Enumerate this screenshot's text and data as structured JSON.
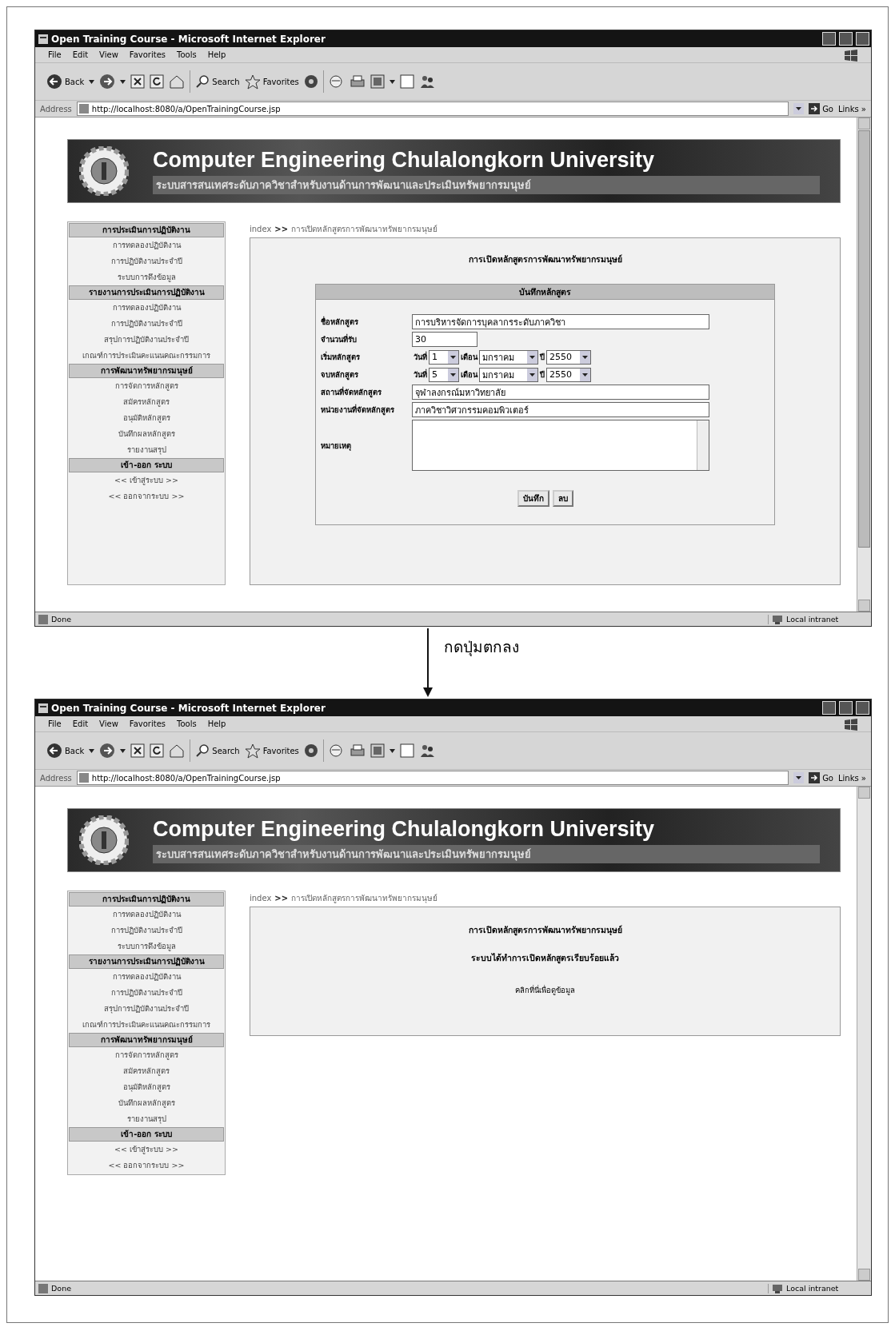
{
  "windows": [
    {
      "title": "Open Training Course - Microsoft Internet Explorer",
      "menu": [
        "File",
        "Edit",
        "View",
        "Favorites",
        "Tools",
        "Help"
      ],
      "toolbar": [
        {
          "label": "Back"
        },
        {
          "label": "Search"
        },
        {
          "label": "Favorites"
        }
      ],
      "address": {
        "label": "Address",
        "url": "http://localhost:8080/a/OpenTrainingCourse.jsp",
        "go": "Go",
        "links": "Links",
        "chevron": "»"
      },
      "scroll_thumb": true,
      "banner": {
        "title": "Computer Engineering Chulalongkorn University",
        "subtitle": "ระบบสารสนเทศระดับภาควิชาสำหรับงานด้านการพัฒนาและประเมินทรัพยากรมนุษย์"
      },
      "sidebar": [
        {
          "heading": "การประเมินการปฏิบัติงาน",
          "items": [
            "การทดลองปฏิบัติงาน",
            "การปฏิบัติงานประจำปี",
            "ระบบการดึงข้อมูล"
          ]
        },
        {
          "heading": "รายงานการประเมินการปฏิบัติงาน",
          "items": [
            "การทดลองปฏิบัติงาน",
            "การปฏิบัติงานประจำปี",
            "สรุปการปฏิบัติงานประจำปี",
            "เกณฑ์การประเมินคะแนนคณะกรรมการ"
          ]
        },
        {
          "heading": "การพัฒนาทรัพยากรมนุษย์",
          "items": [
            "การจัดการหลักสูตร",
            "สมัครหลักสูตร",
            "อนุมัติหลักสูตร",
            "บันทึกผลหลักสูตร",
            "รายงานสรุป"
          ]
        },
        {
          "heading": "เข้า-ออก ระบบ",
          "items": [
            "<< เข้าสู่ระบบ >>",
            "<< ออกจากระบบ >>"
          ]
        }
      ],
      "breadcrumb": {
        "home": "index",
        "separator": ">>",
        "current": "การเปิดหลักสูตรการพัฒนาทรัพยากรมนุษย์"
      },
      "content": {
        "kind": "form",
        "title": "การเปิดหลักสูตรการพัฒนาทรัพยากรมนุษย์",
        "form_title": "บันทึกหลักสูตร",
        "rows": [
          {
            "kind": "text",
            "label": "ชื่อหลักสูตร",
            "value": "การบริหารจัดการบุคลากรระดับภาควิชา"
          },
          {
            "kind": "short",
            "label": "จำนวนที่รับ",
            "value": "30"
          },
          {
            "kind": "date",
            "label": "เริ่มหลักสูตร",
            "day_label": "วันที่",
            "day": "1",
            "month_label": "เดือน",
            "month": "มกราคม",
            "year_label": "ปี",
            "year": "2550"
          },
          {
            "kind": "date",
            "label": "จบหลักสูตร",
            "day_label": "วันที่",
            "day": "5",
            "month_label": "เดือน",
            "month": "มกราคม",
            "year_label": "ปี",
            "year": "2550"
          },
          {
            "kind": "text",
            "label": "สถานที่จัดหลักสูตร",
            "value": "จุฬาลงกรณ์มหาวิทยาลัย"
          },
          {
            "kind": "text",
            "label": "หน่วยงานที่จัดหลักสูตร",
            "value": "ภาควิชาวิศวกรรมคอมพิวเตอร์"
          },
          {
            "kind": "area",
            "label": "หมายเหตุ"
          }
        ],
        "buttons": [
          "บันทึก",
          "ลบ"
        ]
      },
      "status": {
        "text": "Done",
        "zone": "Local intranet"
      }
    },
    {
      "title": "Open Training Course - Microsoft Internet Explorer",
      "menu": [
        "File",
        "Edit",
        "View",
        "Favorites",
        "Tools",
        "Help"
      ],
      "toolbar": [
        {
          "label": "Back"
        },
        {
          "label": "Search"
        },
        {
          "label": "Favorites"
        }
      ],
      "address": {
        "label": "Address",
        "url": "http://localhost:8080/a/OpenTrainingCourse.jsp",
        "go": "Go",
        "links": "Links",
        "chevron": "»"
      },
      "scroll_thumb": false,
      "banner": {
        "title": "Computer Engineering Chulalongkorn University",
        "subtitle": "ระบบสารสนเทศระดับภาควิชาสำหรับงานด้านการพัฒนาและประเมินทรัพยากรมนุษย์"
      },
      "sidebar": [
        {
          "heading": "การประเมินการปฏิบัติงาน",
          "items": [
            "การทดลองปฏิบัติงาน",
            "การปฏิบัติงานประจำปี",
            "ระบบการดึงข้อมูล"
          ]
        },
        {
          "heading": "รายงานการประเมินการปฏิบัติงาน",
          "items": [
            "การทดลองปฏิบัติงาน",
            "การปฏิบัติงานประจำปี",
            "สรุปการปฏิบัติงานประจำปี",
            "เกณฑ์การประเมินคะแนนคณะกรรมการ"
          ]
        },
        {
          "heading": "การพัฒนาทรัพยากรมนุษย์",
          "items": [
            "การจัดการหลักสูตร",
            "สมัครหลักสูตร",
            "อนุมัติหลักสูตร",
            "บันทึกผลหลักสูตร",
            "รายงานสรุป"
          ]
        },
        {
          "heading": "เข้า-ออก ระบบ",
          "items": [
            "<< เข้าสู่ระบบ >>",
            "<< ออกจากระบบ >>"
          ]
        }
      ],
      "breadcrumb": {
        "home": "index",
        "separator": ">>",
        "current": "การเปิดหลักสูตรการพัฒนาทรัพยากรมนุษย์"
      },
      "content": {
        "kind": "message",
        "title": "การเปิดหลักสูตรการพัฒนาทรัพยากรมนุษย์",
        "message": "ระบบได้ทำการเปิดหลักสูตรเรียบร้อยแล้ว",
        "link": "คลิกที่นี่เพื่อดูข้อมูล"
      },
      "status": {
        "text": "Done",
        "zone": "Local intranet"
      }
    }
  ],
  "transition": {
    "label": "กดปุ่มตกลง"
  }
}
